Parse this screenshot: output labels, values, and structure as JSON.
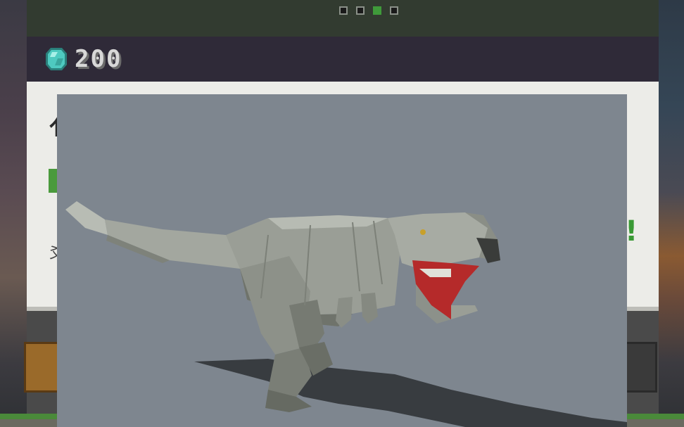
{
  "pager": {
    "total": 4,
    "active_index": 2
  },
  "currency": {
    "icon": "diamond-gem-icon",
    "amount": "200",
    "gem_color": "#4ecac0"
  },
  "panel": {
    "title_fragment": "亻",
    "desc_fragment": "爻",
    "highlight": "!"
  },
  "preview": {
    "subject": "tyrannosaurus-rex-model",
    "background": "#7e868f"
  }
}
